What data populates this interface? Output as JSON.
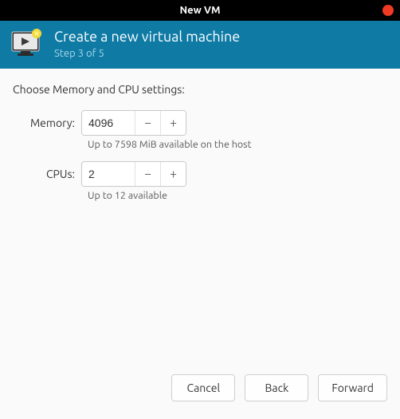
{
  "window": {
    "title": "New VM"
  },
  "header": {
    "title": "Create a new virtual machine",
    "step": "Step 3 of 5"
  },
  "content": {
    "section_title": "Choose Memory and CPU settings:",
    "memory": {
      "label": "Memory:",
      "value": "4096",
      "hint": "Up to 7598 MiB available on the host"
    },
    "cpus": {
      "label": "CPUs:",
      "value": "2",
      "hint": "Up to 12 available"
    }
  },
  "footer": {
    "cancel": "Cancel",
    "back": "Back",
    "forward": "Forward"
  },
  "icons": {
    "minus": "−",
    "plus": "+"
  }
}
